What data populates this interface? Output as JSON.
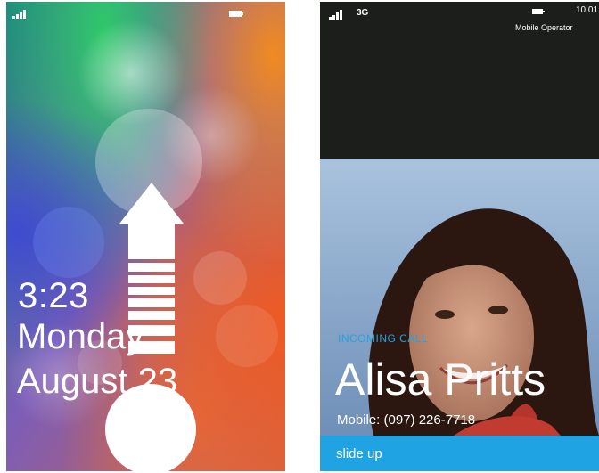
{
  "lock_screen": {
    "time": "3:23",
    "day": "Monday",
    "date": "August 23",
    "icons": {
      "signal": "signal-bars-icon",
      "battery": "battery-icon",
      "swipe_hint": "arrow-up-icon",
      "unlock_handle": "circle-handle-icon"
    }
  },
  "incoming_call": {
    "status": {
      "network": "3G",
      "clock": "10:01",
      "operator": "Mobile Operator"
    },
    "label": "INCOMING CALL",
    "caller_name": "Alisa Pritts",
    "caller_number": "Mobile: (097) 226-7718",
    "action": "slide up",
    "accent_color": "#1fa3e3"
  }
}
